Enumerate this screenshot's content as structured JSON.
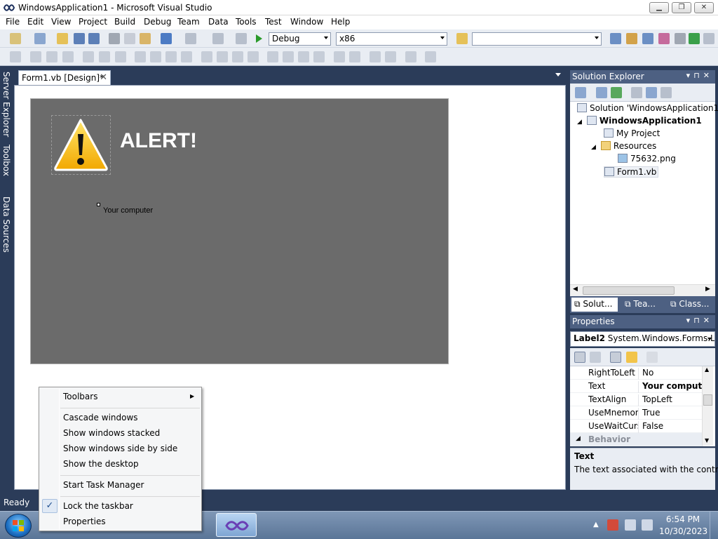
{
  "window": {
    "title": "WindowsApplication1 - Microsoft Visual Studio"
  },
  "menubar": [
    "File",
    "Edit",
    "View",
    "Project",
    "Build",
    "Debug",
    "Team",
    "Data",
    "Tools",
    "Test",
    "Window",
    "Help"
  ],
  "toolbar": {
    "config": "Debug",
    "platform": "x86",
    "find_value": ""
  },
  "left_tabs": [
    "Server Explorer",
    "Toolbox",
    "Data Sources"
  ],
  "document": {
    "tab_label": "Form1.vb [Design]*",
    "close_glyph": "✕"
  },
  "form": {
    "title_label": "ALERT!",
    "body_label": "Your computer"
  },
  "solution_explorer": {
    "header": "Solution Explorer",
    "tree": [
      {
        "label": "Solution 'WindowsApplication1'",
        "bold": false
      },
      {
        "label": "WindowsApplication1",
        "bold": true
      },
      {
        "label": "My Project",
        "bold": false
      },
      {
        "label": "Resources",
        "bold": false
      },
      {
        "label": "75632.png",
        "bold": false
      },
      {
        "label": "Form1.vb",
        "bold": false
      }
    ],
    "tabs": [
      "Solut...",
      "Tea...",
      "Class..."
    ]
  },
  "properties": {
    "header": "Properties",
    "object_name": "Label2",
    "object_type": "System.Windows.Forms.La",
    "rows": [
      {
        "name": "RightToLeft",
        "value": "No"
      },
      {
        "name": "Text",
        "value": "Your computer"
      },
      {
        "name": "TextAlign",
        "value": "TopLeft"
      },
      {
        "name": "UseMnemoni",
        "value": "True"
      },
      {
        "name": "UseWaitCursc",
        "value": "False"
      }
    ],
    "category": "Behavior",
    "desc_title": "Text",
    "desc_body": "The text associated with the control."
  },
  "status": {
    "text": "Ready"
  },
  "taskbar": {
    "time": "6:54 PM",
    "date": "10/30/2023"
  },
  "context_menu": {
    "items": [
      "Toolbars",
      "Cascade windows",
      "Show windows stacked",
      "Show windows side by side",
      "Show the desktop",
      "Start Task Manager",
      "Lock the taskbar",
      "Properties"
    ],
    "check_glyph": "✓",
    "submenu_glyph": "▶"
  },
  "colors": {
    "accent": "#2b3c59",
    "panel_header": "#4d6082",
    "form_bg": "#6b6b6b"
  }
}
